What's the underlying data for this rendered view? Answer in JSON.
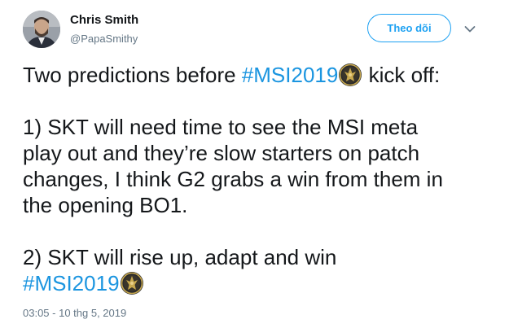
{
  "author": {
    "name": "Chris Smith",
    "handle": "@PapaSmithy"
  },
  "actions": {
    "follow_label": "Theo dõi",
    "more_icon": "chevron-down-icon"
  },
  "tweet": {
    "para1": {
      "before": "Two predictions before ",
      "hashtag": "#MSI2019",
      "after": " kick off:"
    },
    "para2": [
      "1) SKT will need time to see the MSI meta",
      "play out and they’re slow starters on patch",
      "changes, I think G2 grabs a win from them in",
      "the opening BO1."
    ],
    "para3": {
      "line1": "2) SKT will rise up, adapt and win",
      "hashtag": "#MSI2019"
    },
    "emoji_icon": "msi-trophy-emblem-icon"
  },
  "timestamp": "03:05 - 10 thg 5, 2019",
  "colors": {
    "link": "#1b95e0",
    "follow_border": "#1da1f2",
    "secondary_text": "#657786"
  }
}
